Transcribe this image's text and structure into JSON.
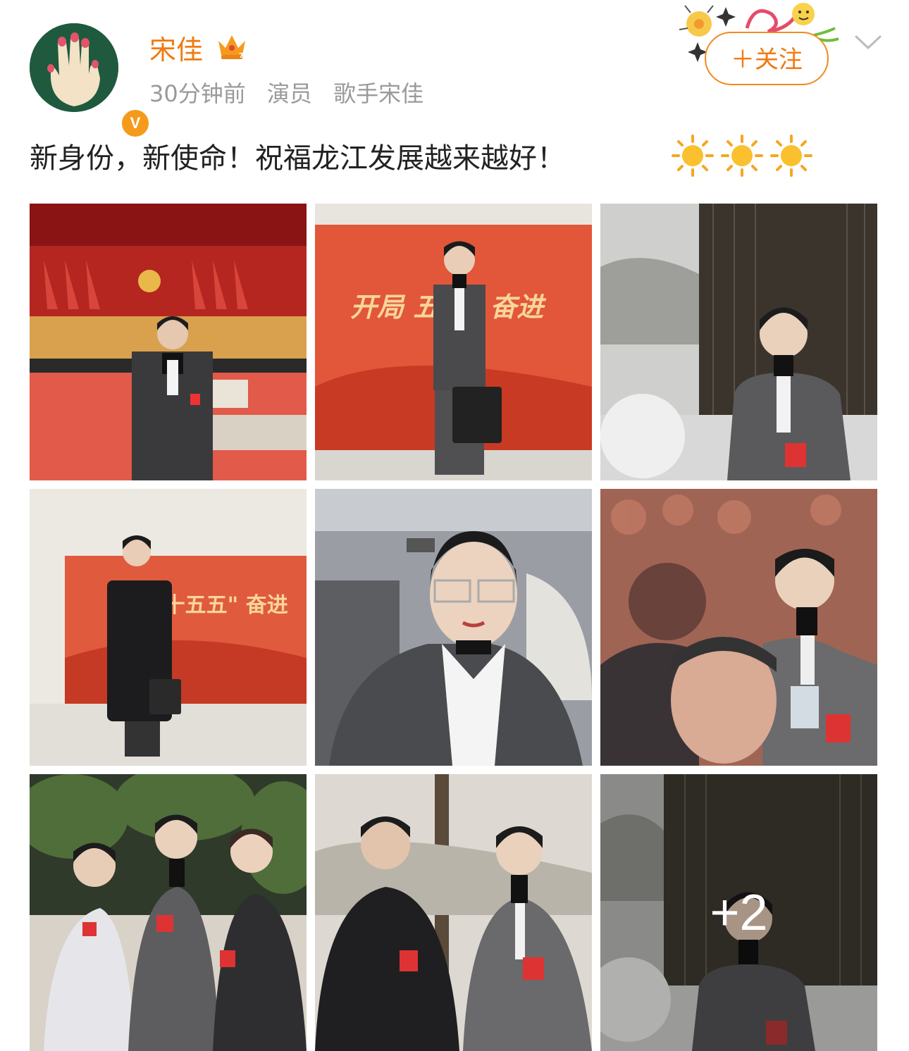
{
  "user": {
    "name": "宋佳",
    "verified_badge": "V"
  },
  "meta": {
    "time": "30分钟前",
    "tags": [
      "演员",
      "歌手宋佳"
    ]
  },
  "follow_label": "＋关注",
  "post_text": "新身份，新使命！祝福龙江发展越来越好！",
  "emojis": [
    "sun-emoji",
    "sun-emoji",
    "sun-emoji"
  ],
  "photos": [
    {
      "name": "photo-auditorium-stage",
      "banner": ""
    },
    {
      "name": "photo-red-backdrop",
      "banner": "开局 五五\" 奋进"
    },
    {
      "name": "photo-seated-portrait",
      "banner": ""
    },
    {
      "name": "photo-backdrop-coat",
      "banner": "\"十五五\" 奋进"
    },
    {
      "name": "photo-car-selfie",
      "banner": ""
    },
    {
      "name": "photo-meeting-audience",
      "banner": ""
    },
    {
      "name": "photo-group-three",
      "banner": ""
    },
    {
      "name": "photo-with-colleague",
      "banner": ""
    },
    {
      "name": "photo-more",
      "banner": ""
    }
  ],
  "more_count": "+2",
  "colors": {
    "accent": "#f07a10",
    "meta": "#9a9a9a",
    "text": "#222222"
  }
}
